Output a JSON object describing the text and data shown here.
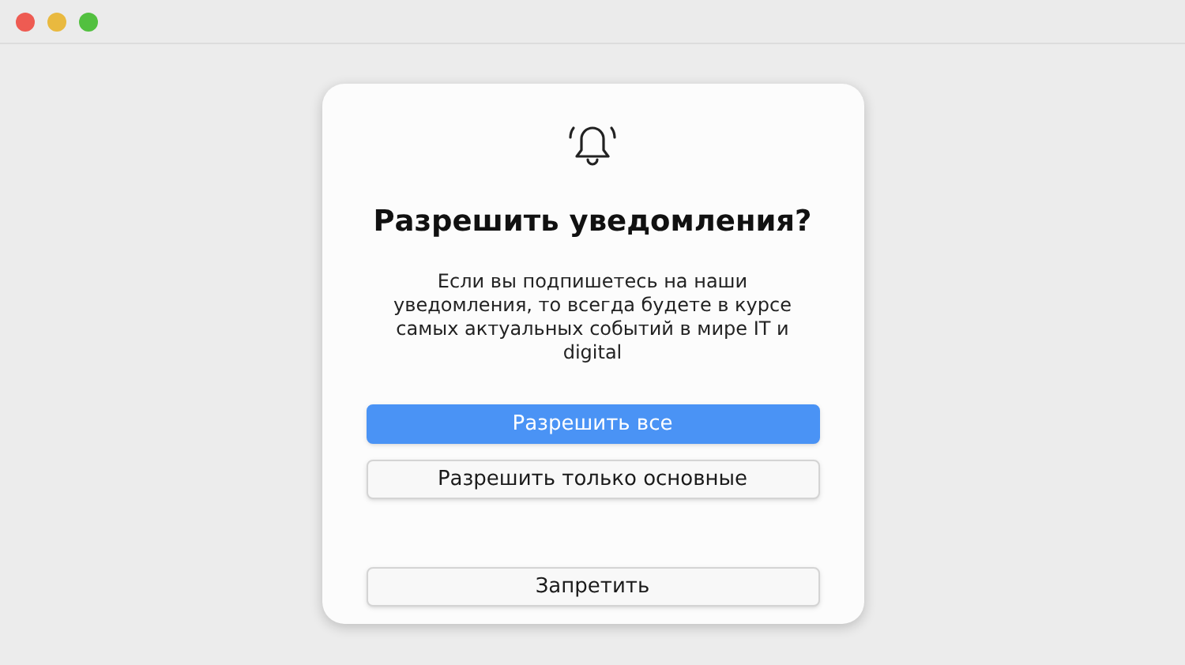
{
  "dialog": {
    "title": "Разрешить уведомления?",
    "message": "Если вы подпишетесь на наши уведомления, то всегда будете в курсе самых актуальных событий в мире IT и digital",
    "buttons": [
      {
        "label": "Разрешить все",
        "kind": "primary"
      },
      {
        "label": "Разрешить только основные",
        "kind": "secondary"
      },
      {
        "label": "Запретить",
        "kind": "secondary"
      }
    ]
  }
}
